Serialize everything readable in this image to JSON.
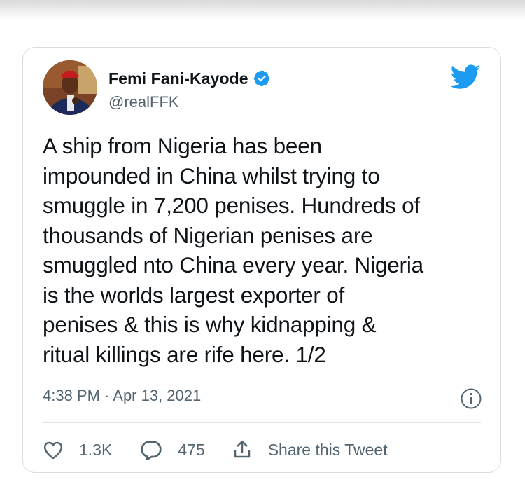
{
  "tweet": {
    "author": {
      "display_name": "Femi Fani-Kayode",
      "handle": "@realFFK",
      "verified": true,
      "avatar_icon": "user-photo"
    },
    "text": "A ship from Nigeria has been\nimpounded in China whilst trying to\nsmuggle in 7,200 penises. Hundreds of\nthousands of Nigerian penises are\nsmuggled nto China every year. Nigeria\nis the worlds largest exporter of\npenises & this is why kidnapping &\nritual killings are rife here. 1/2",
    "timestamp": "4:38 PM · Apr 13, 2021",
    "likes": "1.3K",
    "replies": "475",
    "share_label": "Share this Tweet"
  },
  "icons": {
    "brand": "twitter-bird-icon",
    "verified": "verified-badge-icon",
    "info": "info-icon",
    "like": "heart-icon",
    "reply": "reply-bubble-icon",
    "share": "share-icon"
  },
  "colors": {
    "brand": "#1d9bf0",
    "text": "#0f1419",
    "muted": "#536471",
    "border": "#d8dde2"
  }
}
